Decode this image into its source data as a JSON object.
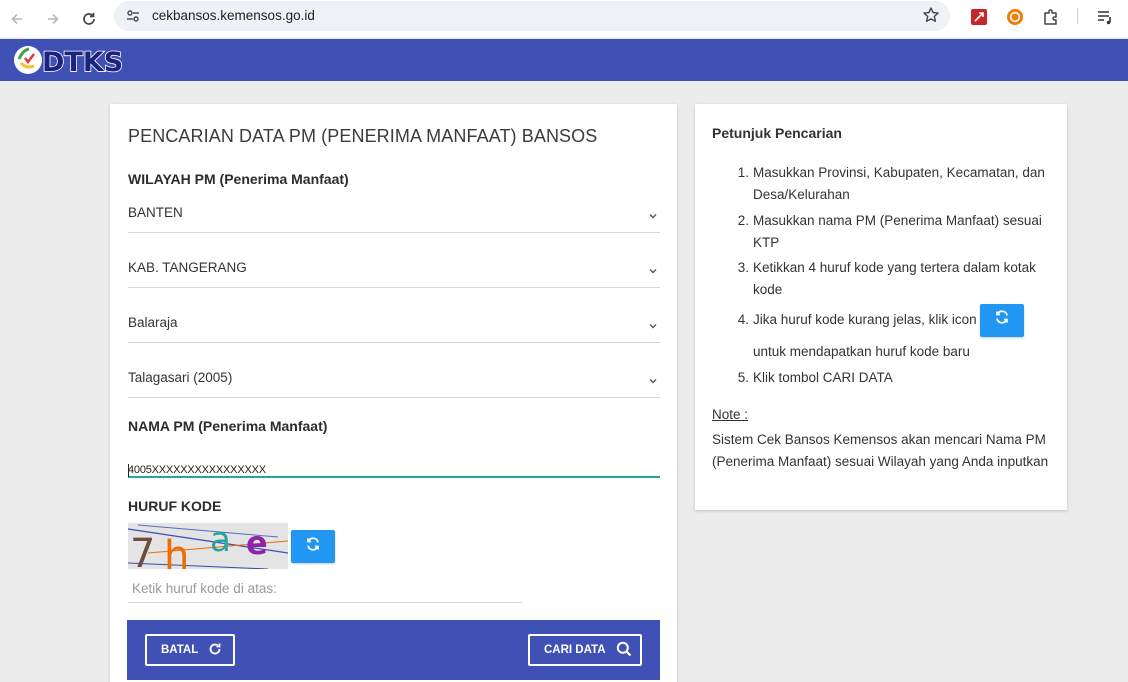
{
  "browser": {
    "url": "cekbansos.kemensos.go.id",
    "icons": [
      "back-arrow-icon",
      "forward-arrow-icon",
      "reload-icon",
      "site-settings-icon",
      "bookmark-star-icon",
      "pdf-extension-icon",
      "duckduckgo-extension-icon",
      "extensions-puzzle-icon",
      "media-queue-icon"
    ]
  },
  "header": {
    "logo_text": "DTKS",
    "background": "#3f51b5"
  },
  "form": {
    "title": "PENCARIAN DATA PM (PENERIMA MANFAAT) BANSOS",
    "region_label": "WILAYAH PM (Penerima Manfaat)",
    "province": "BANTEN",
    "regency": "KAB. TANGERANG",
    "district": "Balaraja",
    "village": "Talagasari (2005)",
    "name_label": "NAMA PM (Penerima Manfaat)",
    "name_value": "4005XXXXXXXXXXXXXXXX",
    "captcha_label": "HURUF KODE",
    "captcha_code": "7hae",
    "captcha_placeholder": "Ketik huruf kode di atas:",
    "cancel_label": "BATAL",
    "search_label": "CARI DATA"
  },
  "help": {
    "title": "Petunjuk Pencarian",
    "steps": [
      {
        "num": "1.",
        "text": "Masukkan Provinsi, Kabupaten, Kecamatan, dan Desa/Kelurahan"
      },
      {
        "num": "2.",
        "text": "Masukkan nama PM (Penerima Manfaat) sesuai KTP"
      },
      {
        "num": "3.",
        "text": "Ketikkan 4 huruf kode yang tertera dalam kotak kode"
      },
      {
        "num": "4.",
        "text": "Jika huruf kode kurang jelas, klik icon",
        "text_after": "untuk mendapatkan huruf kode baru"
      },
      {
        "num": "5.",
        "text": "Klik tombol CARI DATA"
      }
    ],
    "note_title": "Note :",
    "note_text": "Sistem Cek Bansos Kemensos akan mencari Nama PM (Penerima Manfaat) sesuai Wilayah yang Anda inputkan"
  },
  "colors": {
    "primary": "#3f51b5",
    "refresh_button": "#2196f3",
    "input_focus": "#26a69a"
  }
}
